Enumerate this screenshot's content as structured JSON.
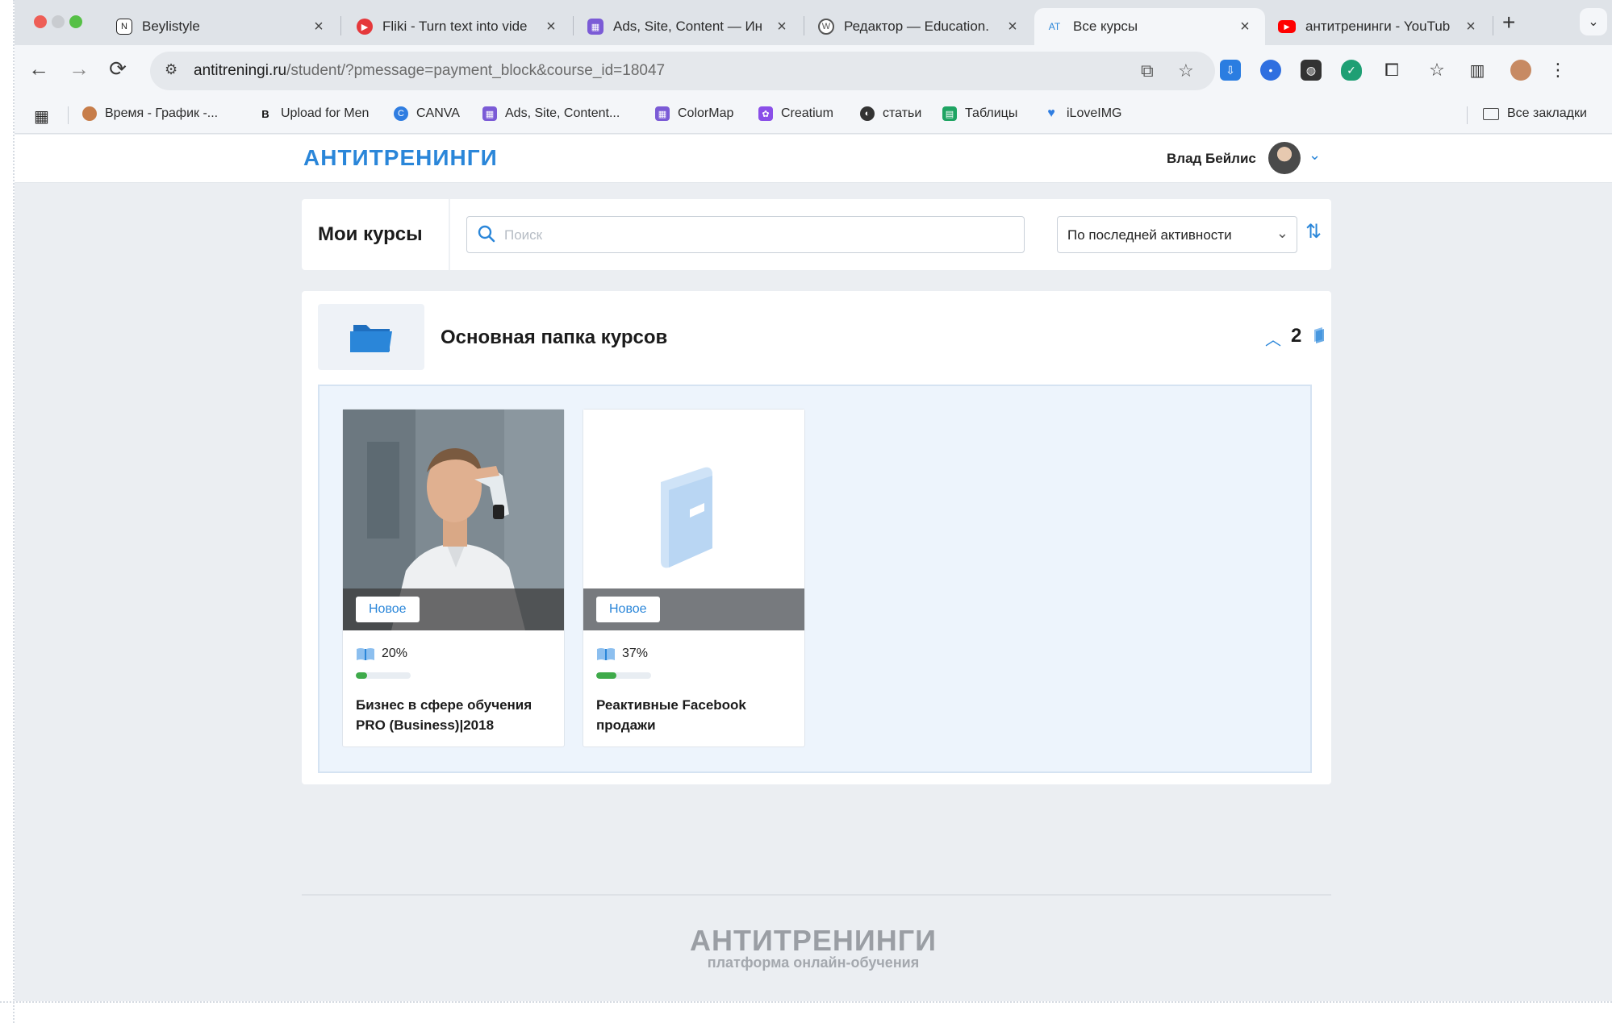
{
  "browser": {
    "tabs": [
      {
        "title": "Beylistyle",
        "icon": "notion-icon",
        "color": "#2b2b2b"
      },
      {
        "title": "Fliki - Turn text into vide",
        "icon": "fliki-icon",
        "color": "#e5383b"
      },
      {
        "title": "Ads, Site, Content — Ин",
        "icon": "board-icon",
        "color": "#7b5bd6"
      },
      {
        "title": "Редактор — Education.",
        "icon": "wordpress-icon",
        "color": "#555555"
      },
      {
        "title": "Все курсы",
        "icon": "antitreningi-icon",
        "color": "#2a86d9",
        "active": true
      },
      {
        "title": "антитренинги - YouTub",
        "icon": "youtube-icon",
        "color": "#ff0000"
      }
    ],
    "url_host": "antitreningi.ru",
    "url_path": "/student/?pmessage=payment_block&course_id=18047",
    "bookmarks": [
      {
        "label": "Время - График -...",
        "icon": "person-icon",
        "color": "#c77d4a"
      },
      {
        "label": "Upload for Men",
        "icon": "b-icon",
        "color": "#111111"
      },
      {
        "label": "CANVA",
        "icon": "canva-icon",
        "color": "#2f7de1"
      },
      {
        "label": "Ads, Site, Content...",
        "icon": "board-icon",
        "color": "#7b5bd6"
      },
      {
        "label": "ColorMap",
        "icon": "board-icon",
        "color": "#7b5bd6"
      },
      {
        "label": "Creatium",
        "icon": "creatium-icon",
        "color": "#8a4fe8"
      },
      {
        "label": "статьи",
        "icon": "globe-icon",
        "color": "#333333"
      },
      {
        "label": "Таблицы",
        "icon": "sheets-icon",
        "color": "#1fa463"
      },
      {
        "label": "iLoveIMG",
        "icon": "heart-icon",
        "color": "#2f7de1"
      }
    ],
    "all_bookmarks": "Все закладки"
  },
  "site": {
    "logo": "АНТИТРЕНИНГИ",
    "username": "Влад Бейлис"
  },
  "courses": {
    "title": "Мои курсы",
    "search_placeholder": "Поиск",
    "sort_value": "По последней активности"
  },
  "folder": {
    "title": "Основная папка курсов",
    "count": "2",
    "items": [
      {
        "badge": "Новое",
        "progress_label": "20%",
        "progress": 0.2,
        "title": "Бизнес в сфере обучения PRO (Business)|2018",
        "has_photo": true
      },
      {
        "badge": "Новое",
        "progress_label": "37%",
        "progress": 0.37,
        "title": "Реактивные Facebook продажи",
        "has_photo": false
      }
    ]
  },
  "footer": {
    "logo": "АНТИТРЕНИНГИ",
    "subtitle": "платформа онлайн-обучения"
  },
  "colors": {
    "accent": "#2a86d9",
    "progress": "#3eaa4a",
    "page_bg": "#ebeef2"
  }
}
